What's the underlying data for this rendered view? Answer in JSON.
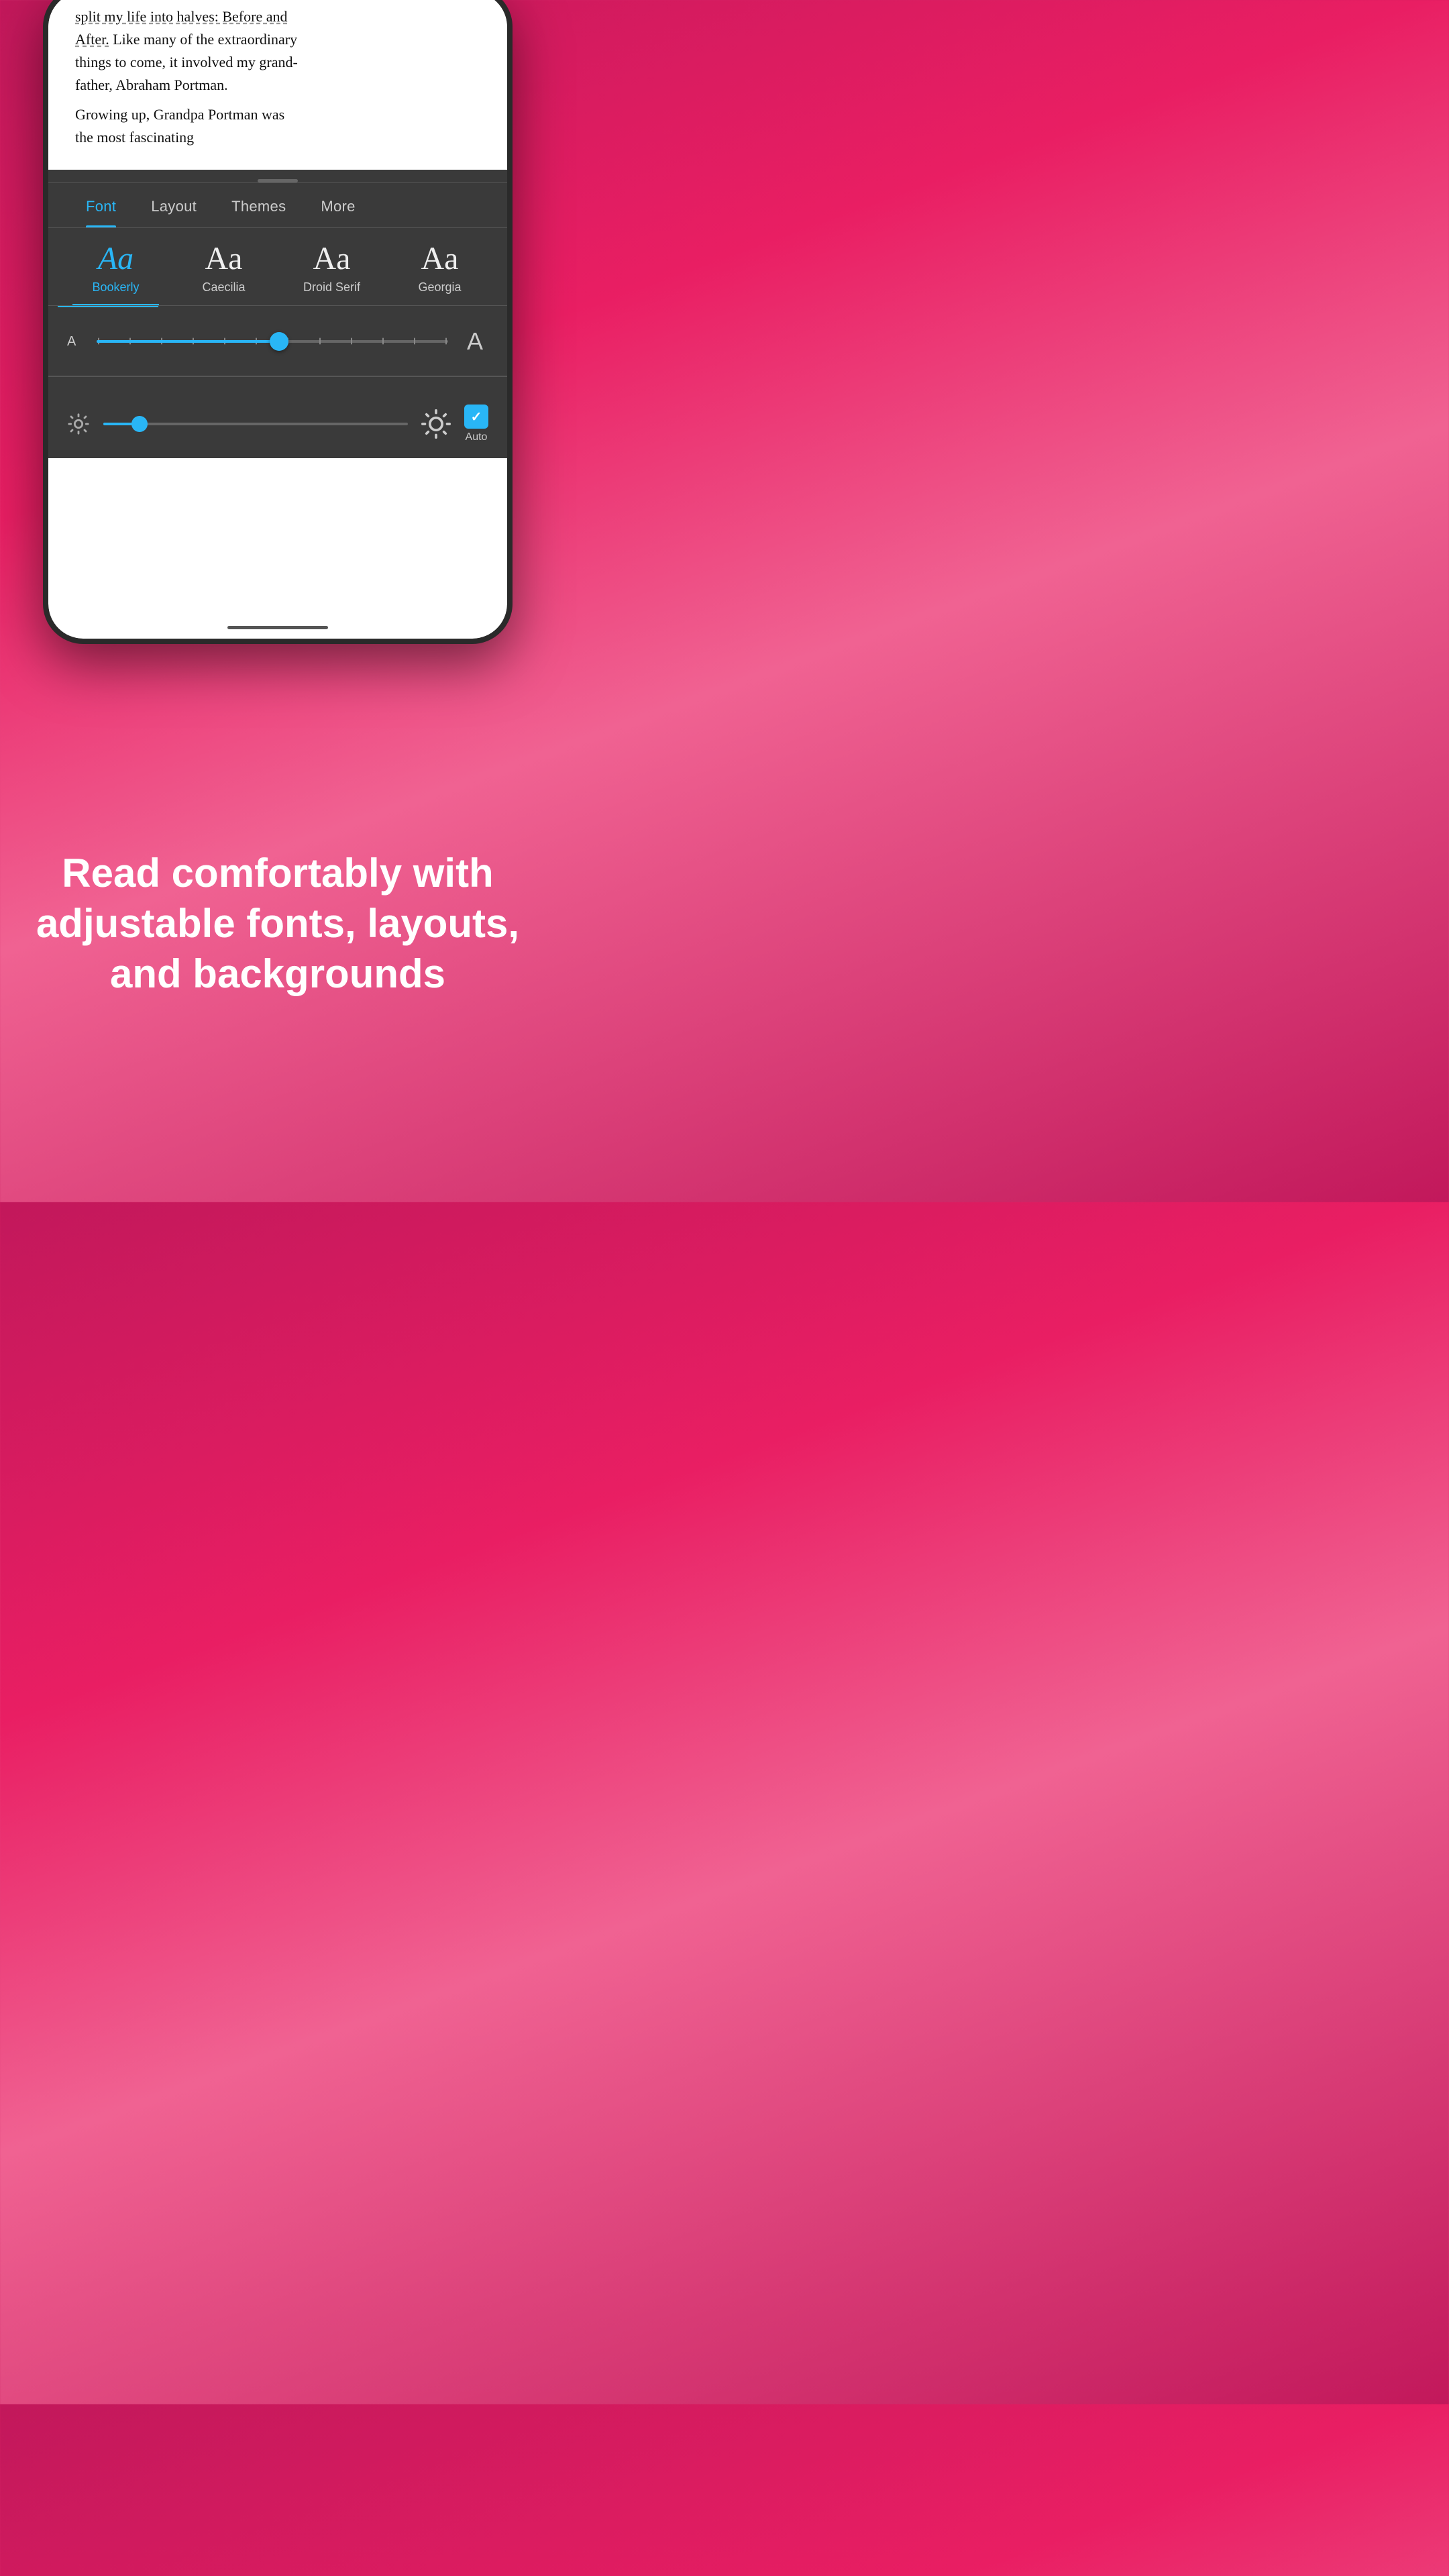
{
  "tabs": [
    {
      "id": "font",
      "label": "Font",
      "active": true
    },
    {
      "id": "layout",
      "label": "Layout",
      "active": false
    },
    {
      "id": "themes",
      "label": "Themes",
      "active": false
    },
    {
      "id": "more",
      "label": "More",
      "active": false
    }
  ],
  "font_options": [
    {
      "id": "bookerly",
      "sample": "Aa",
      "name": "Bookerly",
      "selected": true
    },
    {
      "id": "caecilia",
      "sample": "Aa",
      "name": "Caecilia",
      "selected": false
    },
    {
      "id": "droid_serif",
      "sample": "Aa",
      "name": "Droid Serif",
      "selected": false
    },
    {
      "id": "georgia",
      "sample": "Aa",
      "name": "Georgia",
      "selected": false
    }
  ],
  "font_size": {
    "small_label": "A",
    "large_label": "A",
    "position_percent": 52
  },
  "brightness": {
    "position_percent": 12,
    "auto_label": "Auto",
    "auto_checked": true
  },
  "book_text": {
    "line1": "split my life into halves: Before and",
    "line2": "After. Like many of the extraordinary",
    "line3": "things to come, it involved my grand-",
    "line4": "father, Abraham Portman.",
    "line5": "Growing up, Grandpa Portman was",
    "line6": "the most fascinating"
  },
  "promo": {
    "headline": "Read comfortably with adjustable fonts, layouts, and backgrounds"
  },
  "colors": {
    "accent": "#29b6f6",
    "background_panel": "#3a3a3a",
    "text_primary": "#eeeeee",
    "text_secondary": "#cccccc"
  }
}
